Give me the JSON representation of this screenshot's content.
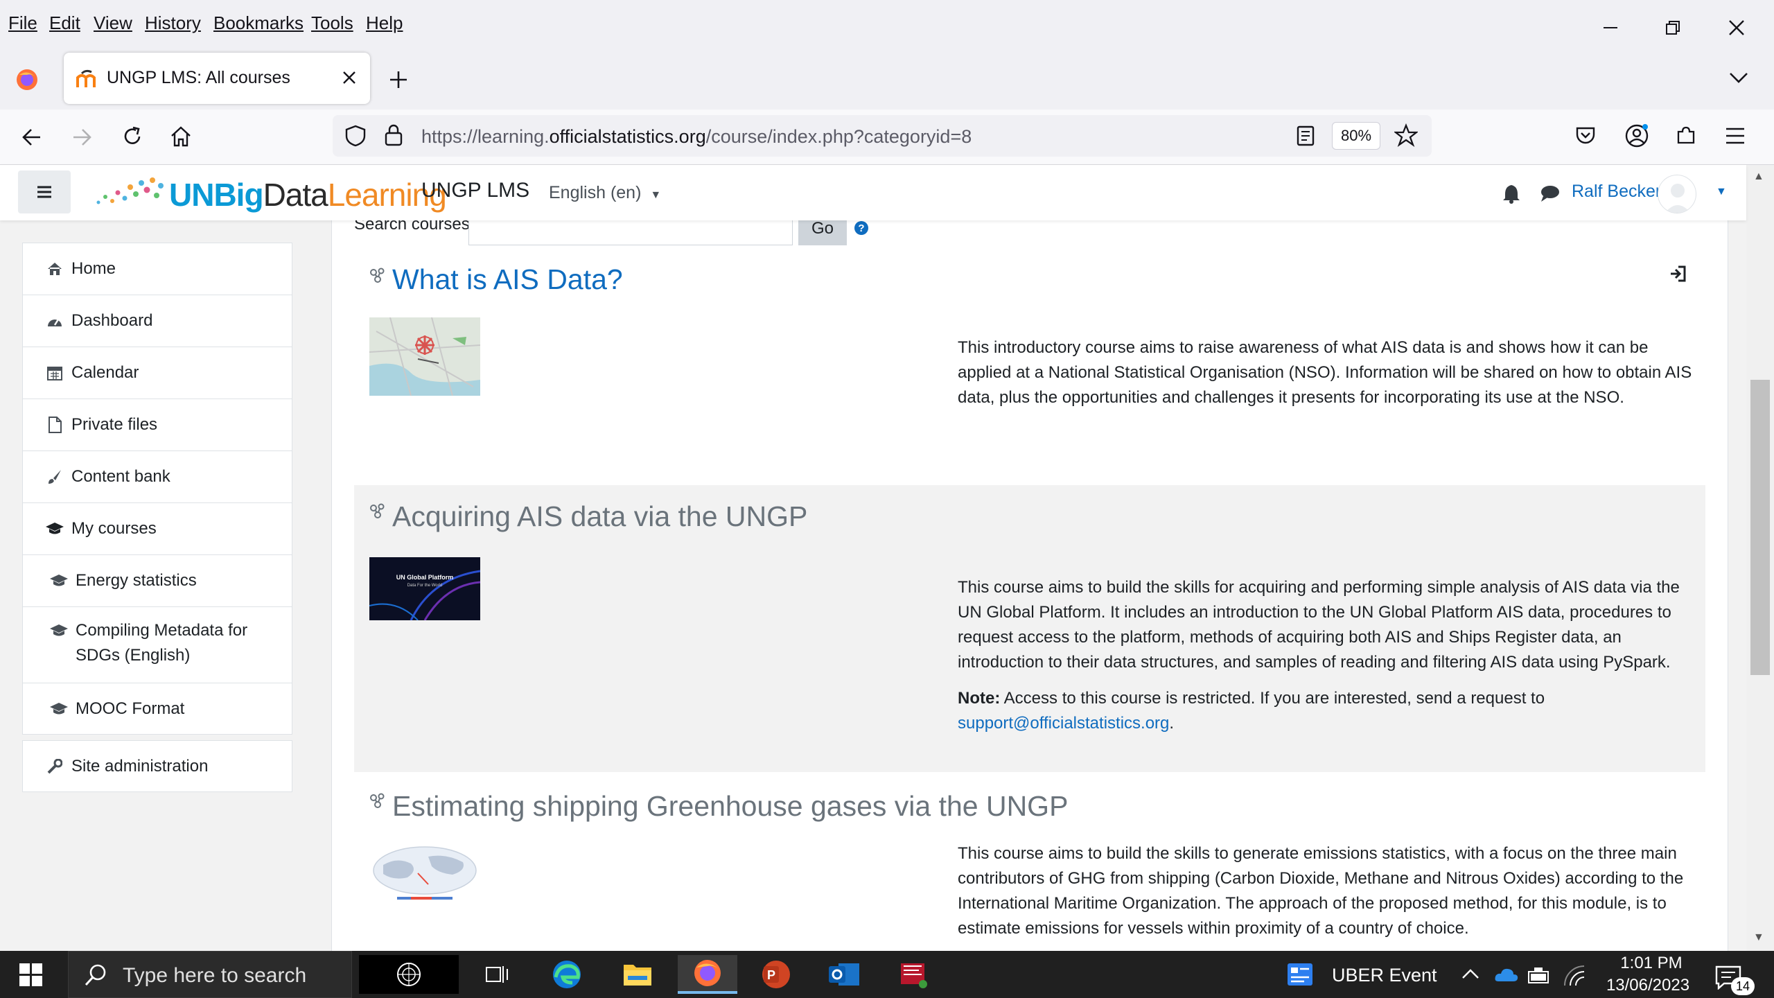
{
  "browser": {
    "menu": [
      "File",
      "Edit",
      "View",
      "History",
      "Bookmarks",
      "Tools",
      "Help"
    ],
    "tab_title": "UNGP LMS: All courses",
    "url_prefix": "https://learning.",
    "url_domain": "officialstatistics.org",
    "url_path": "/course/index.php?categoryid=8",
    "zoom": "80%"
  },
  "header": {
    "logo_un": "UN",
    "logo_big": "Big",
    "logo_data": "Data",
    "logo_learning": "Learning",
    "site_name": "UNGP LMS",
    "language": "English (en)",
    "username": "Ralf Becker"
  },
  "nav": {
    "home": "Home",
    "dashboard": "Dashboard",
    "calendar": "Calendar",
    "private_files": "Private files",
    "content_bank": "Content bank",
    "my_courses": "My courses",
    "energy_statistics": "Energy statistics",
    "compiling_metadata": "Compiling Metadata for SDGs (English)",
    "mooc_format": "MOOC Format",
    "site_admin": "Site administration"
  },
  "search": {
    "label": "Search courses",
    "go": "Go"
  },
  "courses": [
    {
      "title": "What is AIS Data?",
      "summary": "This introductory course aims to raise awareness of what AIS data is and shows how it can be applied at a National Statistical Organisation (NSO). Information will be shared on how to obtain AIS data, plus the opportunities and challenges it presents for incorporating its use at the NSO."
    },
    {
      "title": "Acquiring AIS data via the UNGP",
      "summary": "This course aims to build the skills for acquiring and performing simple analysis of AIS data via the UN Global Platform. It includes an introduction to the UN Global Platform AIS data, procedures to request access to the platform, methods of acquiring both AIS and Ships Register data, an introduction to their data structures, and samples of reading and filtering AIS data using PySpark.",
      "note_label": "Note:",
      "note_text": "Access to this course is restricted. If you are interested, send a request to",
      "note_email": "support@officialstatistics.org",
      "thumb_title": "UN Global Platform",
      "thumb_subtitle": "Data For the World"
    },
    {
      "title": "Estimating shipping Greenhouse gases via the UNGP",
      "summary": "This course aims to build the skills to generate emissions statistics, with a focus on the three main contributors of GHG from shipping (Carbon Dioxide, Methane and Nitrous Oxides) according to the International Maritime Organization.  The approach of the proposed method, for this module, is to estimate emissions for vessels within proximity of a country of choice."
    }
  ],
  "taskbar": {
    "search_placeholder": "Type here to search",
    "widget": "UBER Event",
    "time": "1:01 PM",
    "date": "13/06/2023",
    "notifications": "14"
  }
}
